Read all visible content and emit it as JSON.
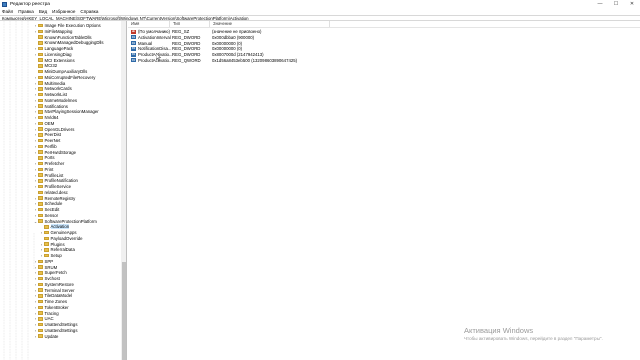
{
  "window": {
    "title": "Редактор реестра",
    "minimize_glyph": "—",
    "maximize_glyph": "☐",
    "close_glyph": "✕"
  },
  "menu": [
    "Файл",
    "Правка",
    "Вид",
    "Избранное",
    "Справка"
  ],
  "address": "Компьютер\\HKEY_LOCAL_MACHINE\\SOFTWARE\\Microsoft\\Windows NT\\CurrentVersion\\SoftwareProtectionPlatform\\Activation",
  "tree": {
    "items": [
      {
        "label": "Image File Execution Options",
        "level": 1,
        "expander": "›"
      },
      {
        "label": "IniFileMapping",
        "level": 1,
        "expander": "›"
      },
      {
        "label": "KnownFunctionTableDlls",
        "level": 1,
        "expander": ""
      },
      {
        "label": "KnownManagedDebuggingDlls",
        "level": 1,
        "expander": ""
      },
      {
        "label": "LanguagePack",
        "level": 1,
        "expander": "›"
      },
      {
        "label": "LicensingDiag",
        "level": 1,
        "expander": "›"
      },
      {
        "label": "MCI Extensions",
        "level": 1,
        "expander": ""
      },
      {
        "label": "MCI32",
        "level": 1,
        "expander": ""
      },
      {
        "label": "MiniDumpAuxiliaryDlls",
        "level": 1,
        "expander": ""
      },
      {
        "label": "MsiCorruptedFileRecovery",
        "level": 1,
        "expander": "›"
      },
      {
        "label": "Multimedia",
        "level": 1,
        "expander": "›"
      },
      {
        "label": "NetworkCards",
        "level": 1,
        "expander": "›"
      },
      {
        "label": "NetworkList",
        "level": 1,
        "expander": "›"
      },
      {
        "label": "NoImeModelmes",
        "level": 1,
        "expander": "›"
      },
      {
        "label": "Notifications",
        "level": 1,
        "expander": "›"
      },
      {
        "label": "NtvrPlayingSessionManager",
        "level": 1,
        "expander": "›"
      },
      {
        "label": "NVid64",
        "level": 1,
        "expander": "›"
      },
      {
        "label": "OEM",
        "level": 1,
        "expander": "›"
      },
      {
        "label": "OpenGLDrivers",
        "level": 1,
        "expander": "›"
      },
      {
        "label": "PeerDist",
        "level": 1,
        "expander": "›"
      },
      {
        "label": "PeerNet",
        "level": 1,
        "expander": "›"
      },
      {
        "label": "Perflib",
        "level": 1,
        "expander": "›"
      },
      {
        "label": "PerHwIdStorage",
        "level": 1,
        "expander": "›"
      },
      {
        "label": "Ports",
        "level": 1,
        "expander": ""
      },
      {
        "label": "Prefetcher",
        "level": 1,
        "expander": "›"
      },
      {
        "label": "Print",
        "level": 1,
        "expander": "›"
      },
      {
        "label": "ProfileList",
        "level": 1,
        "expander": "›"
      },
      {
        "label": "ProfileNotification",
        "level": 1,
        "expander": "›"
      },
      {
        "label": "ProfileService",
        "level": 1,
        "expander": "›"
      },
      {
        "label": "related.desc",
        "level": 1,
        "expander": ""
      },
      {
        "label": "RemoteRegistry",
        "level": 1,
        "expander": "›"
      },
      {
        "label": "Schedule",
        "level": 1,
        "expander": "›"
      },
      {
        "label": "SecEdit",
        "level": 1,
        "expander": "›"
      },
      {
        "label": "Sensor",
        "level": 1,
        "expander": "›"
      },
      {
        "label": "SoftwareProtectionPlatform",
        "level": 1,
        "expander": "⌄"
      },
      {
        "label": "Activation",
        "level": 2,
        "expander": "",
        "selected": true
      },
      {
        "label": "GenuineApps",
        "level": 2,
        "expander": "›"
      },
      {
        "label": "PayloadOverride",
        "level": 2,
        "expander": ""
      },
      {
        "label": "Plugins",
        "level": 2,
        "expander": "›"
      },
      {
        "label": "ReferralData",
        "level": 2,
        "expander": "›"
      },
      {
        "label": "Setup",
        "level": 2,
        "expander": "›"
      },
      {
        "label": "SPP",
        "level": 1,
        "expander": "›"
      },
      {
        "label": "SRUM",
        "level": 1,
        "expander": "›"
      },
      {
        "label": "SuperFetch",
        "level": 1,
        "expander": "›"
      },
      {
        "label": "Svchost",
        "level": 1,
        "expander": "›"
      },
      {
        "label": "SystemRestore",
        "level": 1,
        "expander": "›"
      },
      {
        "label": "Terminal Server",
        "level": 1,
        "expander": "›"
      },
      {
        "label": "TileDataModel",
        "level": 1,
        "expander": "›"
      },
      {
        "label": "Time Zones",
        "level": 1,
        "expander": "›"
      },
      {
        "label": "TokenBroker",
        "level": 1,
        "expander": "›"
      },
      {
        "label": "Tracing",
        "level": 1,
        "expander": "›"
      },
      {
        "label": "UAC",
        "level": 1,
        "expander": "›"
      },
      {
        "label": "UnattendSettings",
        "level": 1,
        "expander": "›"
      },
      {
        "label": "UnattendSettings",
        "level": 1,
        "expander": "›"
      },
      {
        "label": "Update",
        "level": 1,
        "expander": "›"
      }
    ],
    "scroll_thumb": {
      "start": 0.71,
      "end": 1.0
    }
  },
  "values": {
    "columns": {
      "name": "Имя",
      "type": "Тип",
      "data": "Значение"
    },
    "rows": [
      {
        "name": "(По умолчанию)",
        "type": "REG_SZ",
        "data": "(значение не присвоено)",
        "icon": "sz"
      },
      {
        "name": "ActivationInterval",
        "type": "REG_DWORD",
        "data": "0x000dbba0 (900000)",
        "icon": "dw"
      },
      {
        "name": "Manual",
        "type": "REG_DWORD",
        "data": "0x00000000 (0)",
        "icon": "dw"
      },
      {
        "name": "NotificationDisa...",
        "type": "REG_DWORD",
        "data": "0x00000000 (0)",
        "icon": "dw"
      },
      {
        "name": "ProductActivatio...",
        "type": "REG_DWORD",
        "data": "0x8007000d (2147942413)",
        "icon": "dw"
      },
      {
        "name": "ProductActivatio...",
        "type": "REG_QWORD",
        "data": "0x1d56a8453eb500 (132098603890647425)",
        "icon": "dw"
      }
    ]
  },
  "watermark": {
    "line1": "Активация Windows",
    "line2": "Чтобы активировать Windows, перейдите в раздел \"Параметры\"."
  }
}
